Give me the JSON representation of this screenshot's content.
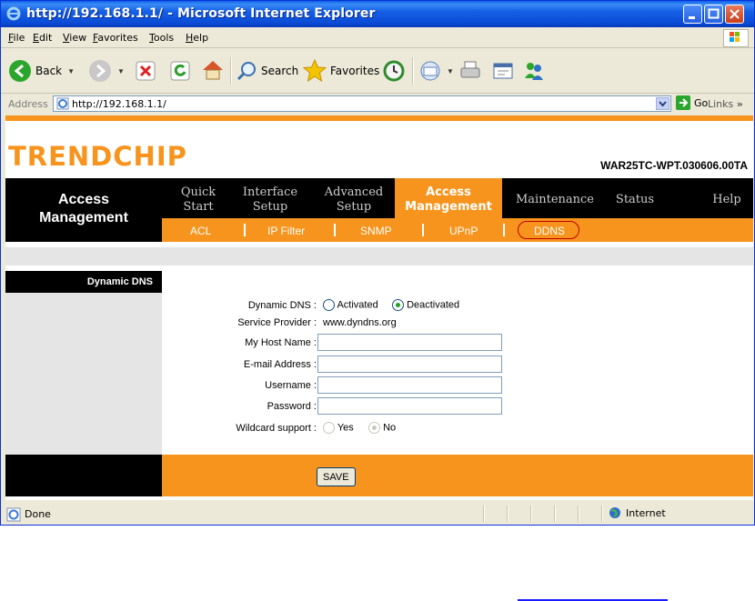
{
  "window": {
    "title": "http://192.168.1.1/ - Microsoft Internet Explorer"
  },
  "menubar": {
    "items": [
      "File",
      "Edit",
      "View",
      "Favorites",
      "Tools",
      "Help"
    ]
  },
  "toolbar": {
    "back_label": "Back",
    "search_label": "Search",
    "favorites_label": "Favorites"
  },
  "addressbar": {
    "label": "Address",
    "url": "http://192.168.1.1/",
    "go_label": "Go",
    "links_label": "Links"
  },
  "router": {
    "logo": "TRENDCHIP",
    "model": "WAR25TC-WPT.030606.00TA",
    "section_title_line1": "Access",
    "section_title_line2": "Management",
    "tabs": [
      {
        "line1": "Quick",
        "line2": "Start"
      },
      {
        "line1": "Interface",
        "line2": "Setup"
      },
      {
        "line1": "Advanced",
        "line2": "Setup"
      },
      {
        "line1": "Access",
        "line2": "Management"
      },
      {
        "line1": "Maintenance",
        "line2": ""
      },
      {
        "line1": "Status",
        "line2": ""
      },
      {
        "line1": "Help",
        "line2": ""
      }
    ],
    "subtabs": [
      "ACL",
      "IP Filter",
      "SNMP",
      "UPnP",
      "DDNS"
    ],
    "side_heading": "Dynamic DNS",
    "form": {
      "dynamic_dns_label": "Dynamic DNS :",
      "activated_label": "Activated",
      "deactivated_label": "Deactivated",
      "service_provider_label": "Service Provider :",
      "service_provider_value": "www.dyndns.org",
      "host_name_label": "My Host Name :",
      "email_label": "E-mail Address :",
      "username_label": "Username :",
      "password_label": "Password :",
      "wildcard_label": "Wildcard support :",
      "yes_label": "Yes",
      "no_label": "No",
      "save_label": "SAVE"
    }
  },
  "statusbar": {
    "status": "Done",
    "zone": "Internet"
  },
  "colors": {
    "accent": "#f7941d",
    "titlebar": "#0a5ee8",
    "nav": "#000000"
  }
}
